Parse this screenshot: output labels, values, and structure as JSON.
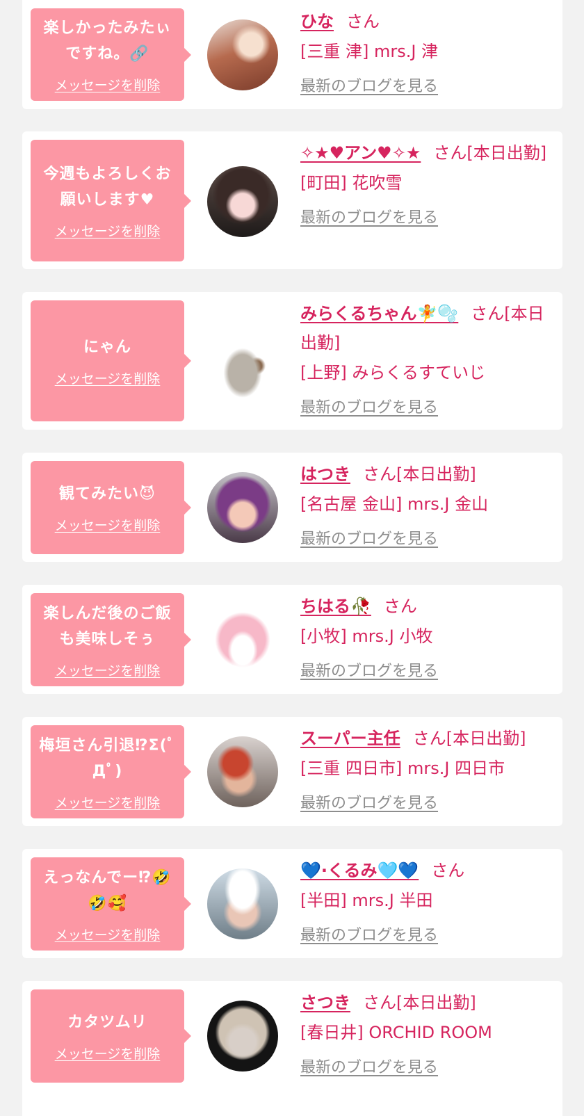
{
  "delete_label": "メッセージを削除",
  "blog_label": "最新のブログを見る",
  "colors": {
    "bubble": "#fc97a4",
    "accent": "#d6245e",
    "link_gray": "#8d8d8d",
    "bg": "#f2f2f2"
  },
  "items": [
    {
      "message": "楽しかったみたぃですね。🔗",
      "name": "ひな",
      "suffix": "さん",
      "shop": "[三重 津] mrs.J 津"
    },
    {
      "message": "今週もよろしくお願いします♥",
      "name": "✧★♥アン♥✧★",
      "suffix": "さん[本日出勤]",
      "shop": "[町田] 花吹雪"
    },
    {
      "message": "にゃん",
      "name": "みらくるちゃん🧚🫧",
      "suffix": "さん[本日出勤]",
      "shop": "[上野] みらくるすていじ"
    },
    {
      "message": "観てみたい😈",
      "name": "はつき",
      "suffix": "さん[本日出勤]",
      "shop": "[名古屋 金山] mrs.J 金山"
    },
    {
      "message": "楽しんだ後のご飯も美味しそぅ",
      "name": "ちはる🥀",
      "suffix": "さん",
      "shop": "[小牧] mrs.J 小牧"
    },
    {
      "message": "梅垣さん引退⁉Σ(ﾟДﾟ)",
      "name": "スーパー主任",
      "suffix": "さん[本日出勤]",
      "shop": "[三重 四日市] mrs.J 四日市"
    },
    {
      "message": "えっなんでー⁉🤣🤣🥰",
      "name": "💙·くるみ🩵💙",
      "suffix": "さん",
      "shop": "[半田] mrs.J 半田"
    },
    {
      "message": "カタツムリ",
      "name": "さつき",
      "suffix": "さん[本日出勤]",
      "shop": "[春日井] ORCHID ROOM"
    }
  ]
}
